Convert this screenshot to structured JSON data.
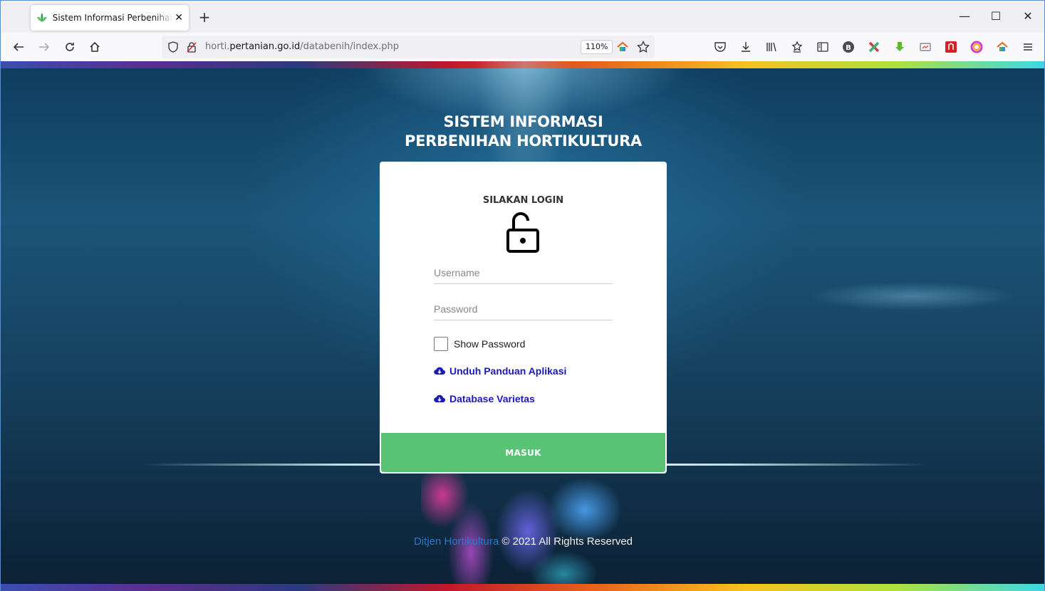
{
  "browser": {
    "tab_title": "Sistem Informasi Perbenihan Hortikultura",
    "new_tab_icon": "plus-icon",
    "url_prefix": "horti.",
    "url_host": "pertanian.go.id",
    "url_path": "/databenih/index.php",
    "zoom": "110%"
  },
  "page": {
    "heading_line1": "SISTEM INFORMASI",
    "heading_line2": "PERBENIHAN HORTIKULTURA",
    "login_title": "SILAKAN LOGIN",
    "username_placeholder": "Username",
    "password_placeholder": "Password",
    "show_password_label": "Show Password",
    "guide_link": "Unduh Panduan Aplikasi",
    "database_link": "Database Varietas",
    "submit_label": "MASUK",
    "footer_org": "Ditjen Hortikultura",
    "footer_copy": "© 2021 All Rights Reserved",
    "accent_color": "#58c374",
    "link_color": "#1a1ab8"
  }
}
